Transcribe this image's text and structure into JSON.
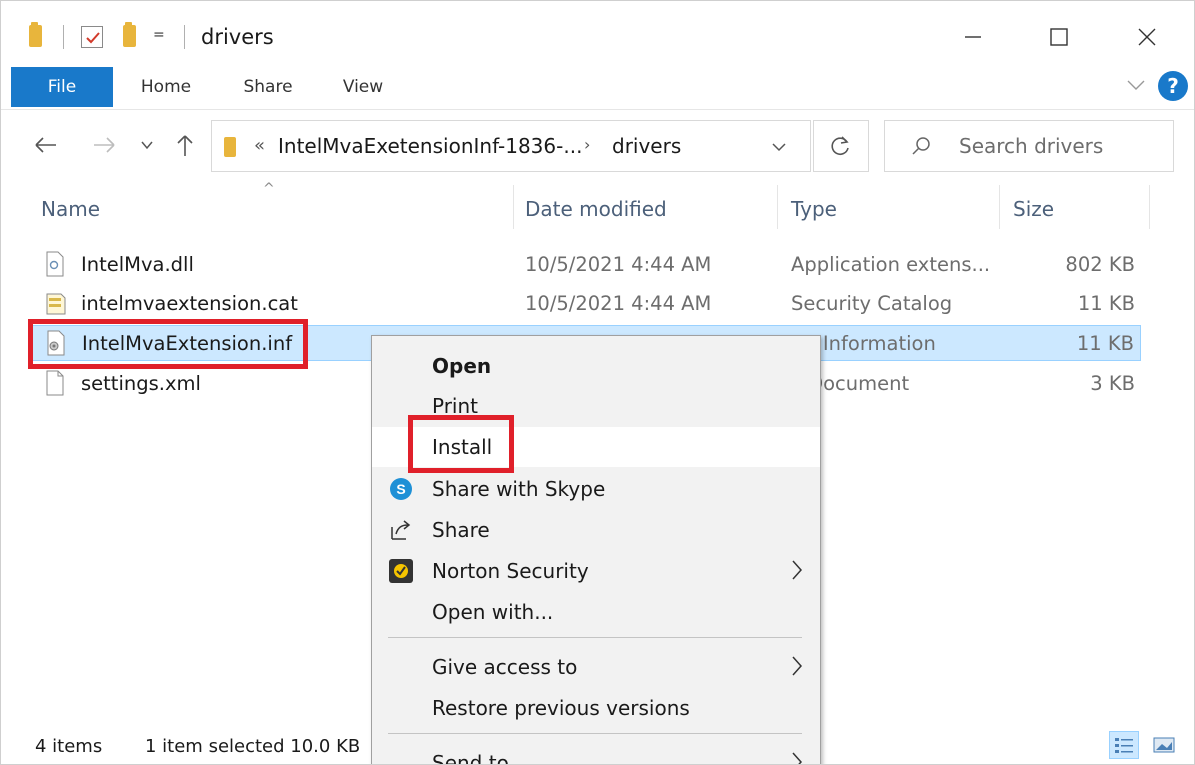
{
  "titlebar": {
    "title": "drivers",
    "dropdown_glyph": "=",
    "icons": [
      "folder-icon",
      "properties-check-icon",
      "new-folder-icon",
      "customize-dropdown-icon"
    ],
    "window_buttons": [
      "minimize",
      "maximize",
      "close"
    ]
  },
  "ribbon": {
    "tabs": [
      {
        "label": "File",
        "active": true
      },
      {
        "label": "Home"
      },
      {
        "label": "Share"
      },
      {
        "label": "View"
      }
    ],
    "help_label": "?"
  },
  "address": {
    "prefix": "«",
    "crumbs": [
      "IntelMvaExetensionInf-1836-...",
      "drivers"
    ],
    "separator": "›",
    "search_placeholder": "Search drivers"
  },
  "columns": [
    "Name",
    "Date modified",
    "Type",
    "Size"
  ],
  "files": [
    {
      "name": "IntelMva.dll",
      "date": "10/5/2021 4:44 AM",
      "type": "Application extens...",
      "size": "802 KB",
      "icon": "dll-file-icon"
    },
    {
      "name": "intelmvaextension.cat",
      "date": "10/5/2021 4:44 AM",
      "type": "Security Catalog",
      "size": "11 KB",
      "icon": "catalog-file-icon"
    },
    {
      "name": "IntelMvaExtension.inf",
      "date": "",
      "type": "up Information",
      "size": "11 KB",
      "icon": "inf-file-icon",
      "selected": true
    },
    {
      "name": "settings.xml",
      "date": "",
      "type": "L Document",
      "size": "3 KB",
      "icon": "xml-file-icon"
    }
  ],
  "context_menu": {
    "items": [
      {
        "label": "Open",
        "bold": true
      },
      {
        "label": "Print"
      },
      {
        "label": "Install",
        "hover": true
      },
      {
        "label": "Share with Skype",
        "icon": "skype-icon"
      },
      {
        "label": "Share",
        "icon": "share-icon"
      },
      {
        "label": "Norton Security",
        "icon": "norton-icon",
        "submenu": true
      },
      {
        "label": "Open with..."
      },
      {
        "label": "Give access to",
        "submenu": true
      },
      {
        "label": "Restore previous versions"
      },
      {
        "label": "Send to",
        "submenu": true
      }
    ]
  },
  "statusbar": {
    "item_count": "4 items",
    "selection": "1 item selected  10.0 KB"
  },
  "colors": {
    "accent": "#1979ca",
    "selection_bg": "#cce8ff",
    "highlight_red": "#e0202a",
    "menu_bg": "#f2f2f2",
    "header_text": "#4c607a"
  }
}
